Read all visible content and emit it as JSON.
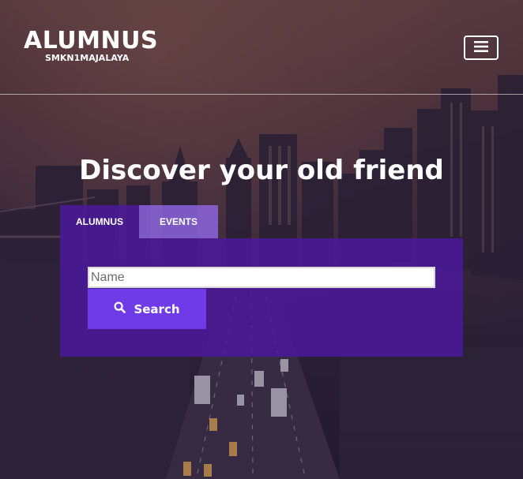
{
  "header": {
    "brand_title": "ALUMNUS",
    "brand_subtitle": "SMKN1MAJALAYA",
    "menu_icon": "hamburger-icon"
  },
  "hero": {
    "title": "Discover your old friend"
  },
  "tabs": [
    {
      "label": "ALUMNUS",
      "active": true
    },
    {
      "label": "EVENTS",
      "active": false
    }
  ],
  "search": {
    "placeholder": "Name",
    "value": "",
    "button_label": "Search",
    "button_icon": "search-icon"
  },
  "colors": {
    "panel": "#4c19a0",
    "tab_inactive": "#8c64dc",
    "button": "#6f3ae8",
    "text": "#ffffff"
  }
}
